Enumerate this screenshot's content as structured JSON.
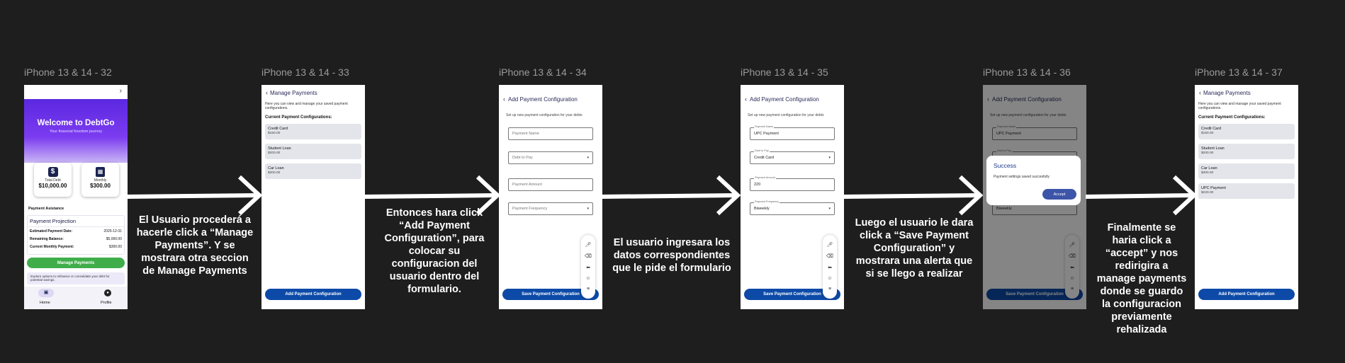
{
  "frames": [
    {
      "label": "iPhone 13 & 14 - 32"
    },
    {
      "label": "iPhone 13 & 14 - 33"
    },
    {
      "label": "iPhone 13 & 14 - 34"
    },
    {
      "label": "iPhone 13 & 14 - 35"
    },
    {
      "label": "iPhone 13 & 14 - 36"
    },
    {
      "label": "iPhone 13 & 14 - 37"
    }
  ],
  "captions": {
    "c1": "El Usuario procederá a hacerle click a “Manage Payments”. Y se mostrara otra seccion de Manage Payments",
    "c2": "Entonces hara click “Add Payment Configuration”, para colocar su configuracion del usuario  dentro del formulario.",
    "c3": "El usuario ingresara los datos correspondientes que le pide el formulario",
    "c4": "Luego el usuario le dara click a “Save Payment Configuration” y mostrara una alerta que si se llego a realizar",
    "c5": "Finalmente se haria click a “accept” y nos redirigira a manage payments donde se guardo la configuracion previamente rehalizada"
  },
  "home": {
    "title": "Welcome to DebtGo",
    "tagline": "Your financial freedom journey",
    "total_label": "Total Debt",
    "total_value": "$10,000.00",
    "monthly_label": "Monthly",
    "monthly_value": "$300.00",
    "assistance": "Payment Asistance",
    "projection_title": "Payment Projection",
    "rows": [
      {
        "k": "Estimated Payment Date:",
        "v": "2025-12-31"
      },
      {
        "k": "Remaining Balance:",
        "v": "$5,000.00"
      },
      {
        "k": "Current Monthly Payment:",
        "v": "$300.00"
      }
    ],
    "manage_btn": "Manage Payments",
    "tip": "Explore options to refinance or consolidate your debt for potential savings.",
    "nav_home": "Home",
    "nav_profile": "Profile"
  },
  "manage": {
    "title": "Manage Payments",
    "intro": "Here you can view and manage your saved payment configurations.",
    "current": "Current Payment Configurations:",
    "cards": [
      {
        "name": "Credit Card",
        "amount": "$150.00"
      },
      {
        "name": "Student Loan",
        "amount": "$200.00"
      },
      {
        "name": "Car Loan",
        "amount": "$300.00"
      }
    ],
    "extra_card": {
      "name": "UPC Payment",
      "amount": "$220.00"
    },
    "add_btn": "Add Payment Configuration"
  },
  "form": {
    "title": "Add Payment Configuration",
    "subtitle": "Set up new payment configuration for your debts",
    "ph_name": "Payment Name",
    "ph_debt": "Debt to Pay",
    "ph_amount": "Payment Amount",
    "ph_freq": "Payment Frequency",
    "val_name": "UPC Payment",
    "val_debt": "Credit Card",
    "val_amount": "220",
    "val_freq": "Biweekly",
    "save_btn": "Save Payment Configuration"
  },
  "alert": {
    "title": "Success",
    "message": "Payment settings saved succesfully",
    "accept": "Accept"
  }
}
